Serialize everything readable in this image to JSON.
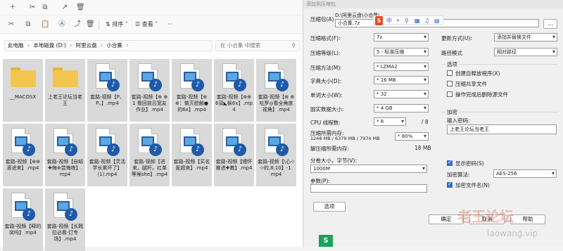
{
  "explorer": {
    "toolbar": {
      "sort_label": "排序",
      "view_label": "查看",
      "more_label": "···"
    },
    "address": [
      "此电脑",
      "本地磁盘 (D:)",
      "阿里云盘",
      "小合集"
    ],
    "address_sep": "›",
    "search_placeholder": "在 小合集 中搜索",
    "files": [
      {
        "name": "__MACOSX",
        "kind": "folder"
      },
      {
        "name": "上老王论坛当老王",
        "kind": "folder"
      },
      {
        "name": "套路-视频【P、P。】.mp4",
        "kind": "video"
      },
      {
        "name": "套路-视频【⊕ ⊕1 看回放吕宽友作业】.mp4",
        "kind": "video"
      },
      {
        "name": "套路-视频【⊕ ⊕：做灭脸触●的6x】.mp4",
        "kind": "video"
      },
      {
        "name": "套路-视频【⊕⊕6双◣枞6x】.mp4",
        "kind": "video"
      },
      {
        "name": "套路-视频【⊕ ⊕吃罗◎看全角度视角】.mp4",
        "kind": "video"
      },
      {
        "name": "套路-视频【⊕⊕滚进来】.mp4",
        "kind": "video"
      },
      {
        "name": "套路-视频【自结✚梅⊕尝悔练】.mp4",
        "kind": "video"
      },
      {
        "name": "套路-视频【灵活学长累坏了】(1).mp4",
        "kind": "video"
      },
      {
        "name": "套路-视频【进来。腿杆。红单等候she】.mp4",
        "kind": "video"
      },
      {
        "name": "套路-视频【买名氰超来】.mp4",
        "kind": "video"
      },
      {
        "name": "套路-视频【缠怀推进✚着】.mp4",
        "kind": "video"
      },
      {
        "name": "套路-视频【\\心⊹⊹的,8.10】-1.mp4",
        "kind": "video"
      },
      {
        "name": "套路-视频【释的突吗】.mp4",
        "kind": "video"
      },
      {
        "name": "套路-视频【长靴拉必看·灯专场】.mp4",
        "kind": "video"
      }
    ]
  },
  "dialog": {
    "title": "添加到压缩包",
    "archive_label": "压缩包(A)",
    "archive_path": "D:\\阿里云盘\\小合集\\",
    "archive_name": "小合集.7z",
    "browse_label": "...",
    "format_label": "压缩格式(F):",
    "format_value": "7z",
    "level_label": "压缩等级(L):",
    "level_value": "5 - 标准压缩",
    "method_label": "压缩方法(M):",
    "method_value": "* LZMA2",
    "dict_label": "字典大小(D):",
    "dict_value": "* 16 MB",
    "word_label": "单词大小(W):",
    "word_value": "* 32",
    "solid_label": "固实数据大小:",
    "solid_value": "* 4 GB",
    "cpu_label": "CPU 线程数:",
    "cpu_value": "* 8",
    "cpu_total": "/ 8",
    "mem_label": "压缩所需内存:",
    "mem_detail": "1248 MB / 6379 MB / 7974 MB",
    "mem_value": "* 80%",
    "decomp_label": "解压缩所需内存:",
    "decomp_value": "18 MB",
    "split_label": "分卷大小，字节(V):",
    "split_value": "1000M",
    "params_label": "参数(P):",
    "options_button": "选项",
    "update_label": "更新方式(U):",
    "update_value": "添加并替换文件",
    "path_label": "路径模式",
    "path_value": "相对路径",
    "options_title": "选项",
    "opt_sfx": "创建自释放程序(X)",
    "opt_shared": "压缩共享文件",
    "opt_delete": "操作完成后删除源文件",
    "encrypt_title": "加密",
    "password_label": "输入密码:",
    "password_value": "上老王论坛当老王",
    "show_password": "显示密码(S)",
    "enc_method_label": "加密算法:",
    "enc_method_value": "AES-256",
    "encrypt_names": "加密文件名(N)",
    "ok_button": "确定",
    "cancel_button": "取消",
    "help_button": "帮助",
    "extra_dropdown_label": "..."
  },
  "ime_bar": {
    "logo": "S",
    "items": [
      "中",
      "•",
      "⚲",
      "▦",
      "♫",
      "▤"
    ]
  },
  "watermark": {
    "line1": "老王论坛",
    "line2": "laowang.vip"
  },
  "taskbar_badge": "S",
  "colors": {
    "folder": "#f4c64e",
    "selection": "#cce4f7",
    "accent": "#2f6dd0",
    "video_icon": "#1e5aa8"
  }
}
